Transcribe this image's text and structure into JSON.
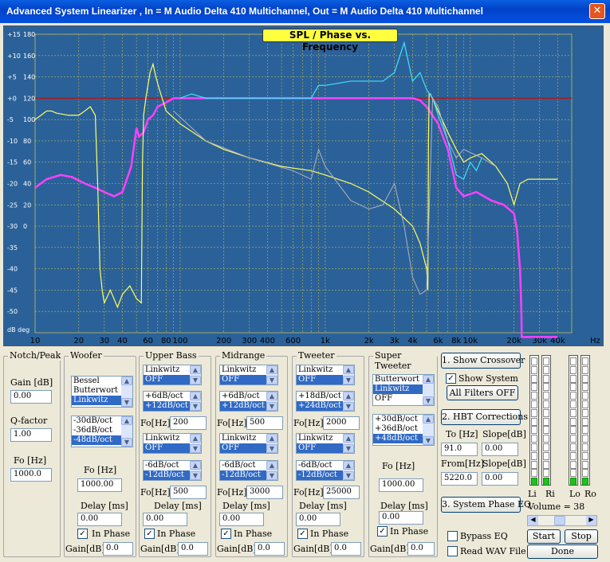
{
  "window": {
    "title": "Advanced System Linearizer , In = M Audio Delta 410 Multichannel, Out = M Audio Delta 410 Multichannel",
    "close_icon": "close-icon"
  },
  "plot": {
    "title": "SPL / Phase vs. Frequency",
    "y_left": [
      "+15",
      "+10",
      "+5",
      "+0",
      "-5",
      "-10",
      "-15",
      "-20",
      "-25",
      "-30",
      "-35",
      "-40",
      "-45",
      "-50"
    ],
    "y_right": [
      "180",
      "160",
      "140",
      "120",
      "100",
      "80",
      "60",
      "40",
      "20",
      "0",
      "",
      "",
      "",
      "",
      ""
    ],
    "y_bottom": "dB deg",
    "x_labels": [
      "10",
      "20",
      "30",
      "40",
      "60",
      "80",
      "100",
      "200",
      "300",
      "400",
      "600",
      "1k",
      "2k",
      "3k",
      "4k",
      "6k",
      "8k",
      "10k",
      "20k",
      "30k",
      "40k",
      "Hz"
    ],
    "colors": {
      "bg": "#2b6199",
      "grid": "#b8b850",
      "red": "#b01818",
      "magenta": "#ff40ff",
      "yellow": "#ffff60",
      "cyan": "#40e0ff",
      "gray": "#b0b0c0"
    }
  },
  "notch": {
    "title": "Notch/Peak",
    "gain_label": "Gain [dB]",
    "gain": "0.00",
    "q_label": "Q-factor",
    "q": "1.00",
    "fo_label": "Fo [Hz]",
    "fo": "1000.0"
  },
  "woofer": {
    "title": "Woofer",
    "filter_types": [
      "Bessel",
      "Butterwort",
      "Linkwitz"
    ],
    "slopes": [
      "-30dB/oct",
      "-36dB/oct",
      "-48dB/oct"
    ],
    "fo_label": "Fo [Hz]",
    "fo": "1000.00",
    "delay_label": "Delay [ms]",
    "delay": "0.00",
    "inphase": "In Phase",
    "gain_label": "Gain[dB]",
    "gain": "0.0"
  },
  "upperbass": {
    "title": "Upper Bass",
    "hp_type": [
      "Linkwitz",
      "OFF"
    ],
    "hp_slope": [
      "+6dB/oct",
      "+12dB/oct"
    ],
    "hp_fo_label": "Fo[Hz]",
    "hp_fo": "200",
    "lp_type": [
      "Linkwitz",
      "OFF"
    ],
    "lp_slope": [
      "-6dB/oct",
      "-12dB/oct"
    ],
    "lp_fo_label": "Fo[Hz]",
    "lp_fo": "500",
    "delay_label": "Delay [ms]",
    "delay": "0.00",
    "inphase": "In Phase",
    "gain_label": "Gain[dB]",
    "gain": "0.0"
  },
  "midrange": {
    "title": "Midrange",
    "hp_type": [
      "Linkwitz",
      "OFF"
    ],
    "hp_slope": [
      "+6dB/oct",
      "+12dB/oct"
    ],
    "hp_fo_label": "Fo[Hz]",
    "hp_fo": "500",
    "lp_type": [
      "Linkwitz",
      "OFF"
    ],
    "lp_slope": [
      "-6dB/oct",
      "-12dB/oct"
    ],
    "lp_fo_label": "Fo[Hz]",
    "lp_fo": "3000",
    "delay_label": "Delay [ms]",
    "delay": "0.00",
    "inphase": "In Phase",
    "gain_label": "Gain[dB]",
    "gain": "0.0"
  },
  "tweeter": {
    "title": "Tweeter",
    "hp_type": [
      "Linkwitz",
      "OFF"
    ],
    "hp_slope": [
      "+18dB/oct",
      "+24dB/oct"
    ],
    "hp_fo_label": "Fo[Hz]",
    "hp_fo": "2000",
    "lp_type": [
      "Linkwitz",
      "OFF"
    ],
    "lp_slope": [
      "-6dB/oct",
      "-12dB/oct"
    ],
    "lp_fo_label": "Fo[Hz]",
    "lp_fo": "25000",
    "delay_label": "Delay [ms]",
    "delay": "0.00",
    "inphase": "In Phase",
    "gain_label": "Gain[dB]",
    "gain": "0.0"
  },
  "supertweeter": {
    "title": "Super Tweeter",
    "types": [
      "Butterwort",
      "Linkwitz",
      "OFF"
    ],
    "slopes": [
      "+30dB/oct",
      "+36dB/oct",
      "+48dB/oct"
    ],
    "fo_label": "Fo [Hz]",
    "fo": "1000.00",
    "delay_label": "Delay [ms]",
    "delay": "0.00",
    "inphase": "In Phase",
    "gain_label": "Gain[dB]",
    "gain": "0.0"
  },
  "right": {
    "show_crossover": "1. Show Crossover",
    "show_system": "Show System",
    "all_filters_off": "All Filters OFF",
    "hbt": "2. HBT Corrections",
    "to_label": "To [Hz]",
    "slope_label": "Slope[dB]",
    "to": "91.0",
    "slope1": "0.00",
    "from_label": "From[Hz]",
    "slope2_label": "Slope[dB]",
    "from": "5220.0",
    "slope2": "0.00",
    "phase_eq": "3. System Phase EQ",
    "bypass_eq": "Bypass EQ",
    "read_wav": "Read WAV File",
    "meters": [
      "Li",
      "Ri",
      "Lo",
      "Ro"
    ],
    "volume": "Volume = 38",
    "start": "Start",
    "stop": "Stop",
    "done": "Done"
  }
}
